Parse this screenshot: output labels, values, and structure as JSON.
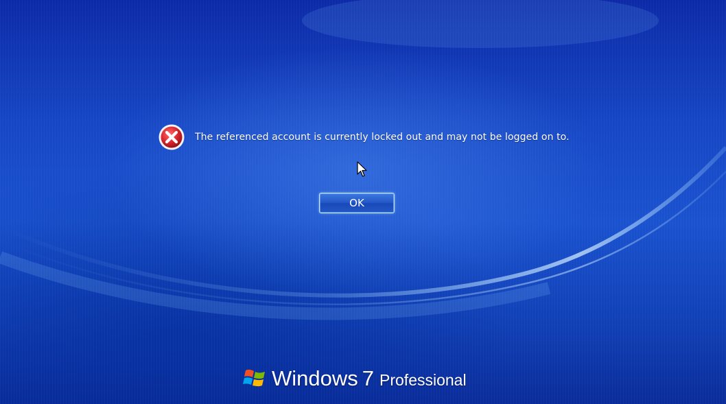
{
  "error": {
    "icon": "error-x-icon",
    "message": "The referenced account is currently locked out and may not be logged on to."
  },
  "dialog": {
    "ok_label": "OK"
  },
  "branding": {
    "logo_icon": "windows-flag-icon",
    "product": "Windows",
    "version": "7",
    "edition": "Professional"
  },
  "colors": {
    "background": "#1a52cf",
    "error_red": "#d6232b",
    "button_border": "#cfe3ff"
  }
}
